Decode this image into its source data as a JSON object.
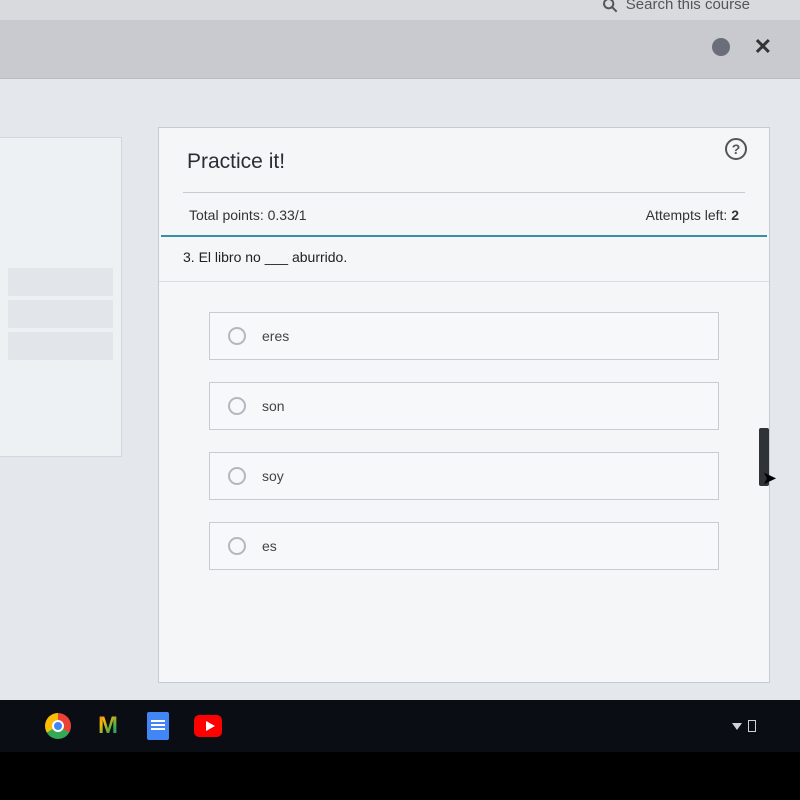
{
  "topbar": {
    "search_label": "Search this course"
  },
  "card": {
    "title": "Practice it!",
    "help_symbol": "?",
    "points_label": "Total points: 0.33/1",
    "attempts_label": "Attempts left: ",
    "attempts_value": "2"
  },
  "question": {
    "text": "3. El libro no ___ aburrido."
  },
  "options": [
    {
      "label": "eres"
    },
    {
      "label": "son"
    },
    {
      "label": "soy"
    },
    {
      "label": "es"
    }
  ],
  "taskbar": {
    "gmail_glyph": "M"
  }
}
